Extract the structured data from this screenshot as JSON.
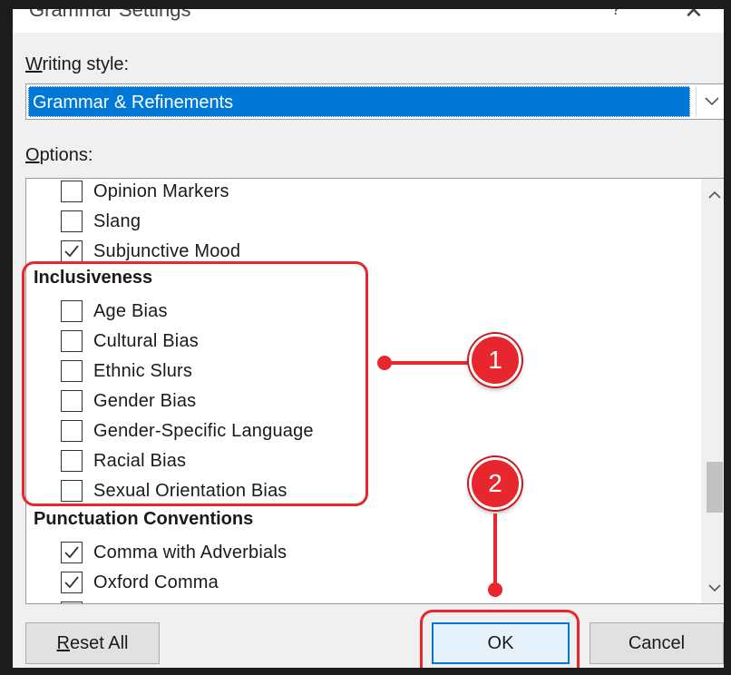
{
  "dialog": {
    "title": "Grammar Settings",
    "help_glyph": "?",
    "close_glyph": "✕"
  },
  "writing_style": {
    "label_accel": "W",
    "label_rest": "riting style:",
    "selected": "Grammar & Refinements"
  },
  "options": {
    "label_accel": "O",
    "label_rest": "ptions:",
    "items_top": [
      {
        "label": "Opinion Markers",
        "checked": false
      },
      {
        "label": "Slang",
        "checked": false
      },
      {
        "label": "Subjunctive Mood",
        "checked": true
      }
    ],
    "group_inclusiveness": "Inclusiveness",
    "inclusiveness_items": [
      {
        "label": "Age Bias",
        "checked": false
      },
      {
        "label": "Cultural Bias",
        "checked": false
      },
      {
        "label": "Ethnic Slurs",
        "checked": false
      },
      {
        "label": "Gender Bias",
        "checked": false
      },
      {
        "label": "Gender-Specific Language",
        "checked": false
      },
      {
        "label": "Racial Bias",
        "checked": false
      },
      {
        "label": "Sexual Orientation Bias",
        "checked": false
      }
    ],
    "group_punctuation": "Punctuation Conventions",
    "punctuation_items": [
      {
        "label": "Comma with Adverbials",
        "checked": true
      },
      {
        "label": "Oxford Comma",
        "checked": true
      }
    ]
  },
  "buttons": {
    "reset_accel": "R",
    "reset_rest": "eset All",
    "ok": "OK",
    "cancel": "Cancel"
  },
  "annotations": {
    "badge_1": "1",
    "badge_2": "2",
    "color": "#e8262d"
  },
  "colors": {
    "accent": "#0078d7",
    "dialog_bg": "#f0f0f0"
  }
}
